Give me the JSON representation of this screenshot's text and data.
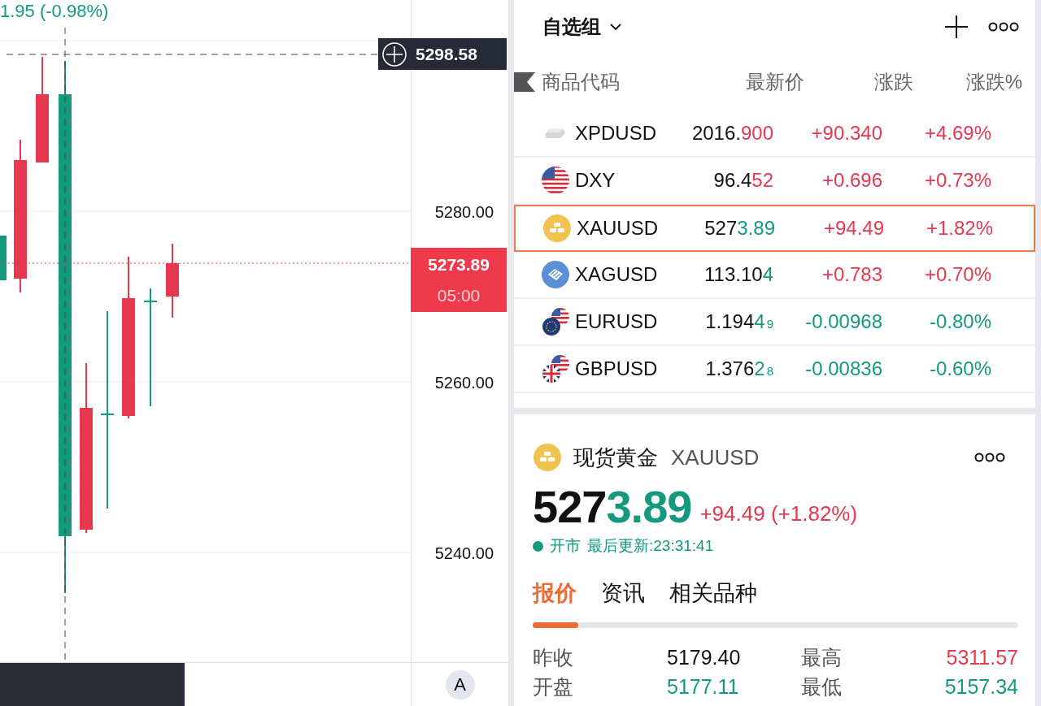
{
  "chart": {
    "header_change": "1.95 (-0.98%)",
    "axis_labels": [
      "5280.00",
      "5260.00",
      "5240.00"
    ],
    "crosshair_label": "5298.58",
    "current_price": "5273.89",
    "countdown": "05:00"
  },
  "bottom_bar": {
    "button": "A"
  },
  "watchlist": {
    "title": "自选组",
    "columns": [
      "商品代码",
      "最新价",
      "涨跌",
      "涨跌%"
    ],
    "rows": [
      {
        "kind": "ingot",
        "symbol": "XPDUSD",
        "price_lead": "2016.",
        "price_tail": "900",
        "tail_up": true,
        "change": "+90.340",
        "pct": "+4.69%",
        "up": true,
        "selected": false
      },
      {
        "kind": "flag-us",
        "symbol": "DXY",
        "price_lead": "96.4",
        "price_tail": "52",
        "tail_up": true,
        "change": "+0.696",
        "pct": "+0.73%",
        "up": true,
        "selected": false
      },
      {
        "kind": "bars-yellow",
        "symbol": "XAUUSD",
        "price_lead": "527",
        "price_tail": "3.89",
        "tail_up": false,
        "change": "+94.49",
        "pct": "+1.82%",
        "up": true,
        "selected": true
      },
      {
        "kind": "bars-blue",
        "symbol": "XAGUSD",
        "price_lead": "113.10",
        "price_tail": "4",
        "tail_up": false,
        "change": "+0.783",
        "pct": "+0.70%",
        "up": true,
        "selected": false
      },
      {
        "kind": "flags-eu-us",
        "symbol": "EURUSD",
        "price_lead": "1.194",
        "price_tail": "4",
        "price_sub": "9",
        "tail_up": false,
        "change": "-0.00968",
        "pct": "-0.80%",
        "up": false,
        "selected": false
      },
      {
        "kind": "flags-gb-us",
        "symbol": "GBPUSD",
        "price_lead": "1.376",
        "price_tail": "2",
        "price_sub": "8",
        "tail_up": false,
        "change": "-0.00836",
        "pct": "-0.60%",
        "up": false,
        "selected": false
      }
    ]
  },
  "detail": {
    "kind": "bars-yellow",
    "name": "现货黄金",
    "code": "XAUUSD",
    "price_lead": "527",
    "price_tail": "3.89",
    "tail_up": false,
    "change": "+94.49 (+1.82%)",
    "up": true,
    "market_open": true,
    "status": "开市",
    "updated": "最后更新:23:31:41",
    "tabs": [
      {
        "label": "报价",
        "selected": true
      },
      {
        "label": "资讯",
        "selected": false
      },
      {
        "label": "相关品种",
        "selected": false
      }
    ],
    "stats": [
      {
        "label": "昨收",
        "value": "5179.40",
        "color": "#111111"
      },
      {
        "label": "最高",
        "value": "5311.57",
        "color": "#e8384f"
      },
      {
        "label": "开盘",
        "value": "5177.11",
        "color": "#14997e"
      },
      {
        "label": "最低",
        "value": "5157.34",
        "color": "#14997e"
      }
    ]
  }
}
